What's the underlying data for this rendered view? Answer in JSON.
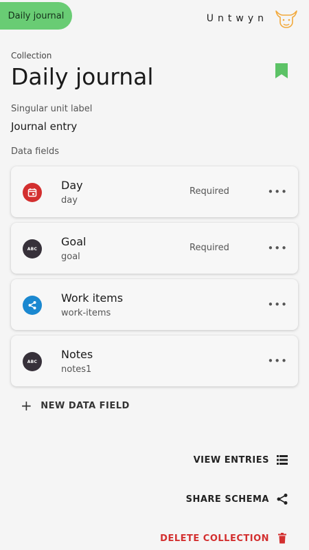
{
  "header": {
    "tab_label": "Daily journal",
    "brand_name": "Untwyn"
  },
  "collection": {
    "label": "Collection",
    "title": "Daily journal",
    "unit_label_caption": "Singular unit label",
    "unit_label_value": "Journal entry",
    "fields_caption": "Data fields"
  },
  "fields": [
    {
      "name": "Day",
      "slug": "day",
      "required": "Required",
      "icon": "calendar-icon",
      "color": "#d32f2f"
    },
    {
      "name": "Goal",
      "slug": "goal",
      "required": "Required",
      "icon": "abc-icon",
      "color": "#37313a"
    },
    {
      "name": "Work items",
      "slug": "work-items",
      "required": "",
      "icon": "share-icon",
      "color": "#1b88d0"
    },
    {
      "name": "Notes",
      "slug": "notes1",
      "required": "",
      "icon": "abc-icon",
      "color": "#37313a"
    }
  ],
  "icons": {
    "abc_text": "ABC",
    "more": "•••"
  },
  "actions": {
    "new_field": "NEW DATA FIELD",
    "view_entries": "VIEW ENTRIES",
    "share_schema": "SHARE SCHEMA",
    "delete_collection": "DELETE COLLECTION"
  },
  "colors": {
    "accent": "#69cc74",
    "bookmark": "#5cc266",
    "danger": "#d32f2f",
    "logo": "#f2a93b"
  }
}
